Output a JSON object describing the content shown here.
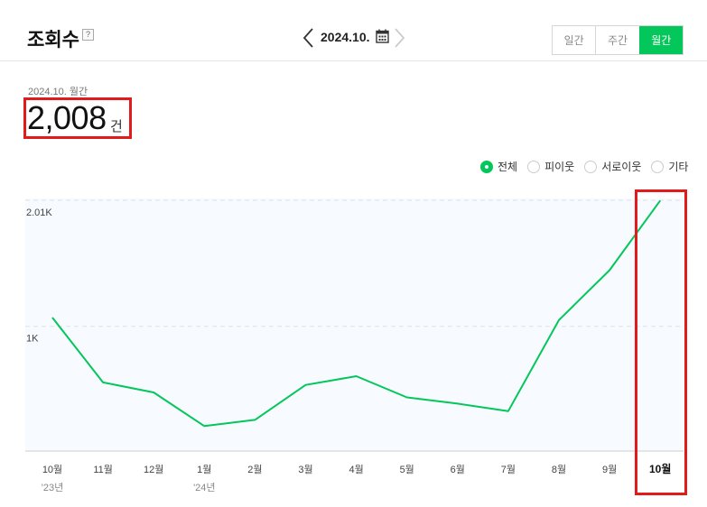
{
  "header": {
    "title": "조회수",
    "help_label": "?",
    "date": "2024.10.",
    "period_tabs": [
      "일간",
      "주간",
      "월간"
    ],
    "active_period": "월간"
  },
  "summary": {
    "period_label": "2024.10. 월간",
    "value": "2,008",
    "unit": "건"
  },
  "legend": {
    "items": [
      "전체",
      "피이웃",
      "서로이웃",
      "기타"
    ],
    "selected": "전체"
  },
  "colors": {
    "accent": "#03c75a",
    "highlight": "#e11b1b",
    "plot_bg": "#f7fafe"
  },
  "chart_data": {
    "type": "line",
    "x": [
      "10월",
      "11월",
      "12월",
      "1월",
      "2월",
      "3월",
      "4월",
      "5월",
      "6월",
      "7월",
      "8월",
      "9월",
      "10월"
    ],
    "year_labels": [
      "'23년",
      "",
      "",
      "'24년",
      "",
      "",
      "",
      "",
      "",
      "",
      "",
      "",
      ""
    ],
    "series": [
      {
        "values": [
          1070,
          550,
          470,
          200,
          250,
          530,
          600,
          430,
          380,
          320,
          1050,
          1450,
          2008
        ],
        "color": "#03c75a"
      }
    ],
    "yticks": [
      1000,
      2010
    ],
    "ytick_labels": [
      "1K",
      "2.01K"
    ],
    "ylim": [
      0,
      2010
    ],
    "grid": true,
    "highlight_index": 12
  }
}
